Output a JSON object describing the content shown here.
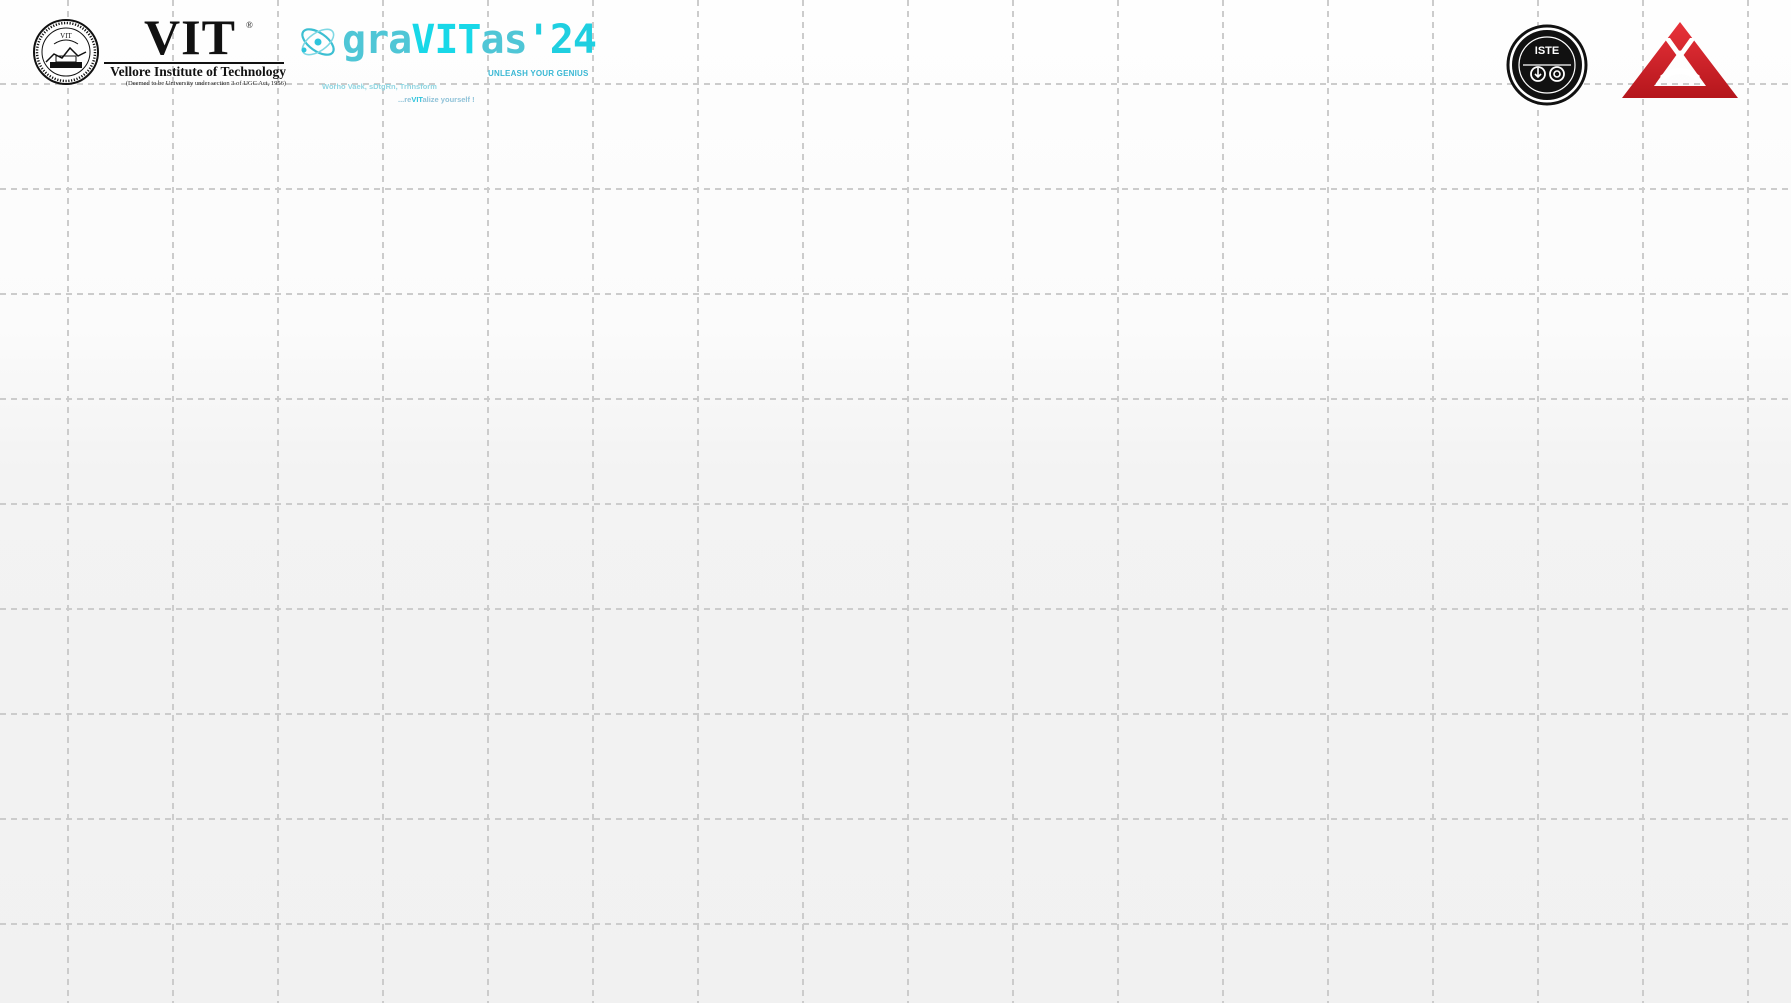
{
  "header": {
    "vit": {
      "wordmark": "VIT",
      "registered": "®",
      "name": "Vellore Institute of Technology",
      "subtitle": "(Deemed to be University under section 3 of UGC Act, 1956)"
    },
    "gravitas": {
      "prefix": "gra",
      "highlight": "VIT",
      "suffix": "as",
      "year": "'24",
      "tagline": "UNLEASH YOUR GENIUS",
      "motto": "Worho Vaek, sDtgRn, Trhnsform",
      "revit_prefix": "...re",
      "revit_highlight": "VIT",
      "revit_suffix": "alize yourself !"
    },
    "iste": {
      "label": "ISTE"
    }
  },
  "colors": {
    "gravitas_cyan": "#18d8e8",
    "gravitas_teal": "#4fc6d6",
    "iste_black": "#111111",
    "red_logo": "#d42027",
    "grid_line": "#cfcfcf"
  },
  "icons": {
    "vit_seal": "vit-seal-icon",
    "atom": "atom-icon",
    "iste": "iste-logo-icon",
    "red": "red-triangle-logo-icon"
  }
}
